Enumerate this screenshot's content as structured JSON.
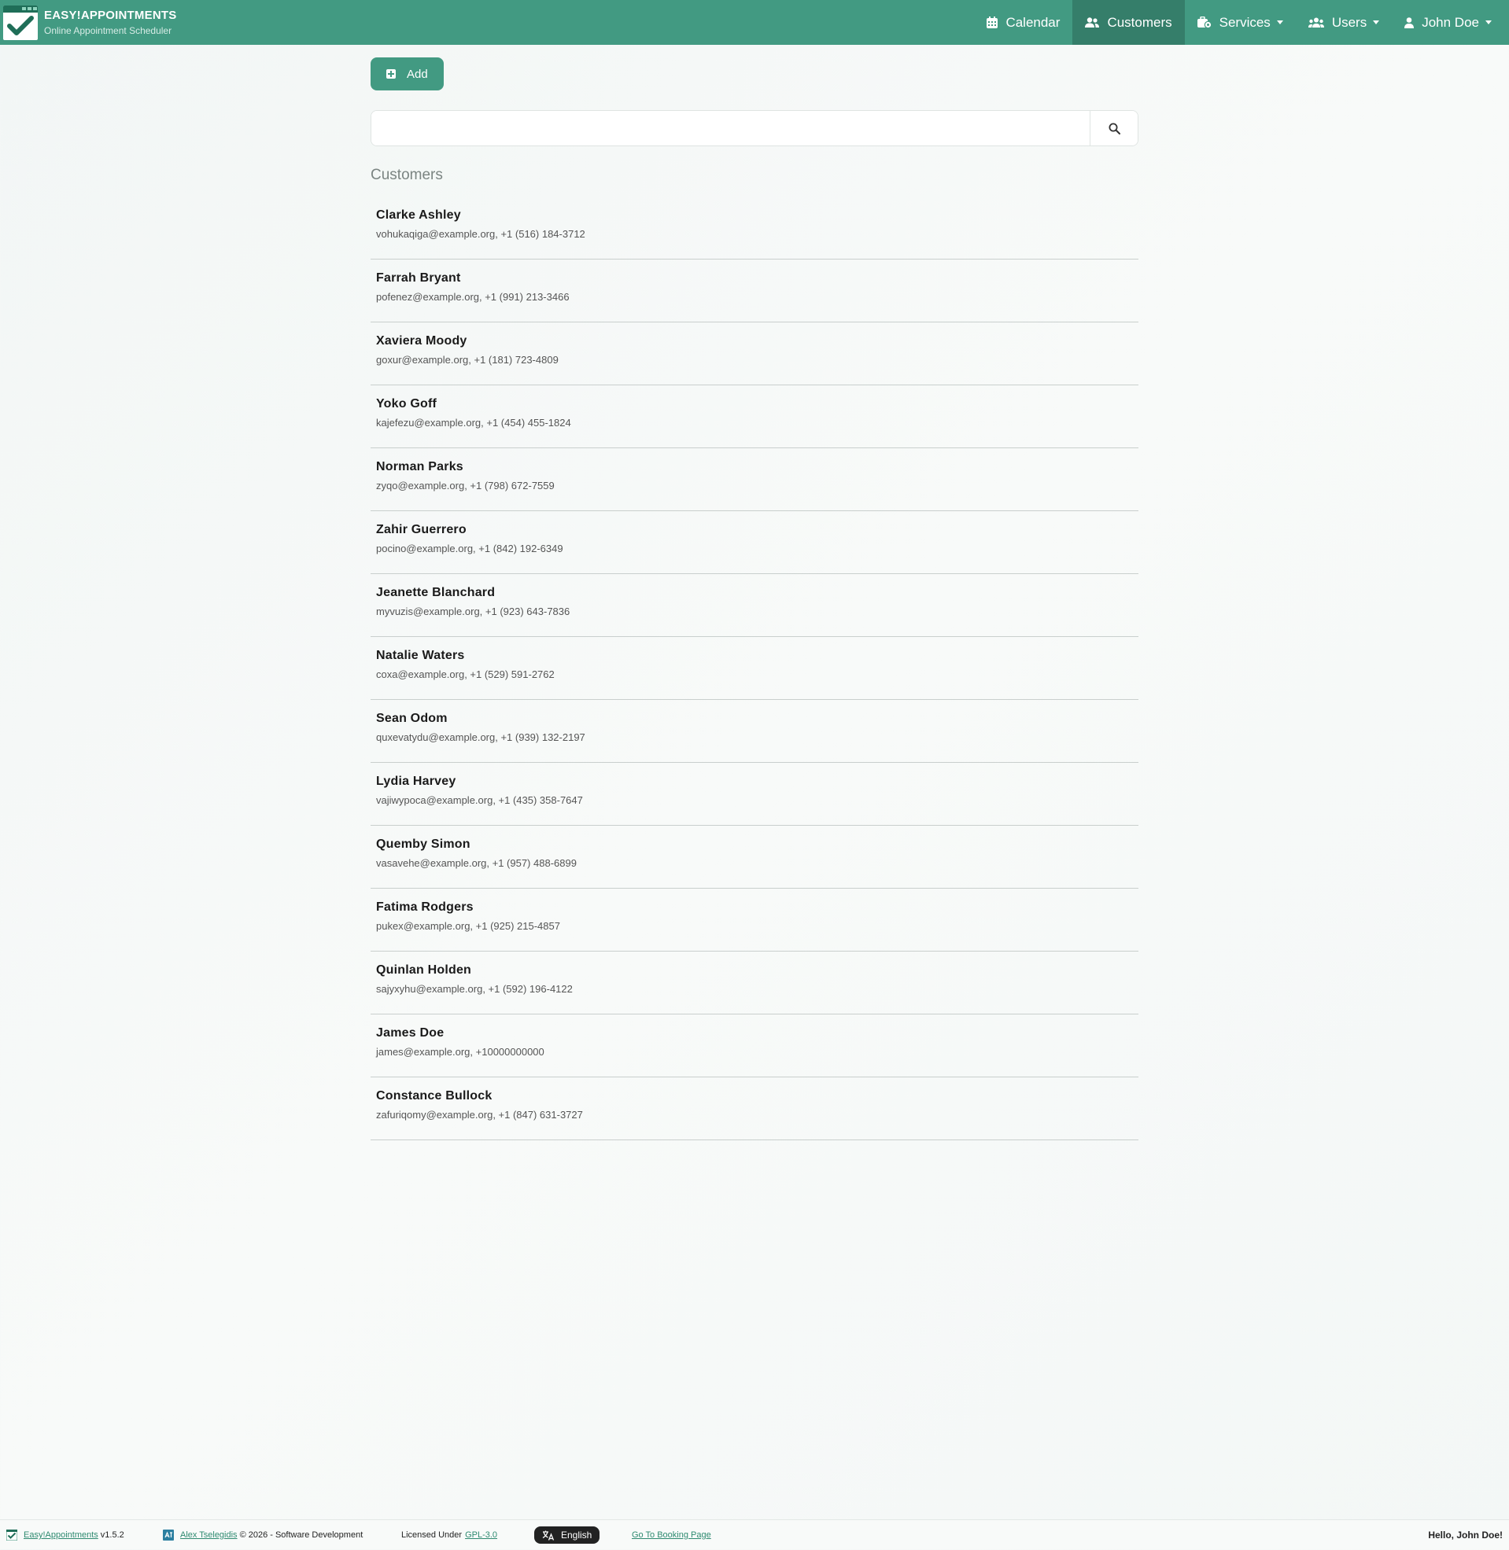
{
  "brand": {
    "title": "EASY!APPOINTMENTS",
    "subtitle": "Online Appointment Scheduler"
  },
  "nav": {
    "calendar": "Calendar",
    "customers": "Customers",
    "services": "Services",
    "users": "Users",
    "account": "John Doe"
  },
  "toolbar": {
    "add_label": "Add"
  },
  "search": {
    "value": "",
    "placeholder": ""
  },
  "list_title": "Customers",
  "customers": [
    {
      "name": "Clarke Ashley",
      "info": "vohukaqiga@example.org, +1 (516) 184-3712"
    },
    {
      "name": "Farrah Bryant",
      "info": "pofenez@example.org, +1 (991) 213-3466"
    },
    {
      "name": "Xaviera Moody",
      "info": "goxur@example.org, +1 (181) 723-4809"
    },
    {
      "name": "Yoko Goff",
      "info": "kajefezu@example.org, +1 (454) 455-1824"
    },
    {
      "name": "Norman Parks",
      "info": "zyqo@example.org, +1 (798) 672-7559"
    },
    {
      "name": "Zahir Guerrero",
      "info": "pocino@example.org, +1 (842) 192-6349"
    },
    {
      "name": "Jeanette Blanchard",
      "info": "myvuzis@example.org, +1 (923) 643-7836"
    },
    {
      "name": "Natalie Waters",
      "info": "coxa@example.org, +1 (529) 591-2762"
    },
    {
      "name": "Sean Odom",
      "info": "quxevatydu@example.org, +1 (939) 132-2197"
    },
    {
      "name": "Lydia Harvey",
      "info": "vajiwypoca@example.org, +1 (435) 358-7647"
    },
    {
      "name": "Quemby Simon",
      "info": "vasavehe@example.org, +1 (957) 488-6899"
    },
    {
      "name": "Fatima Rodgers",
      "info": "pukex@example.org, +1 (925) 215-4857"
    },
    {
      "name": "Quinlan Holden",
      "info": "sajyxyhu@example.org, +1 (592) 196-4122"
    },
    {
      "name": "James Doe",
      "info": "james@example.org, +10000000000"
    },
    {
      "name": "Constance Bullock",
      "info": "zafuriqomy@example.org, +1 (847) 631-3727"
    }
  ],
  "footer": {
    "app_link": "Easy!Appointments",
    "version": "v1.5.2",
    "author_link": "Alex Tselegidis",
    "copyright": "© 2026 - Software Development",
    "license_prefix": "Licensed Under",
    "license_link": "GPL-3.0",
    "language": "English",
    "booking_link": "Go To Booking Page",
    "greeting": "Hello, John Doe!"
  },
  "colors": {
    "primary": "#429a82",
    "primary_dark": "#357e6a",
    "link": "#2e8a70"
  }
}
